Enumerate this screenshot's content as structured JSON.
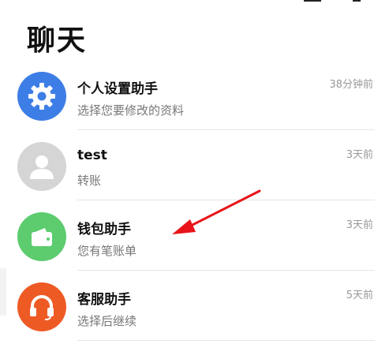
{
  "page": {
    "title": "聊天"
  },
  "chats": [
    {
      "name": "个人设置助手",
      "preview": "选择您要修改的资料",
      "time": "38分钟前",
      "icon": "gear-icon",
      "color": "#3d7de6"
    },
    {
      "name": "test",
      "preview": "转账",
      "time": "3天前",
      "icon": "person-icon",
      "color": "#d5d5d5"
    },
    {
      "name": "钱包助手",
      "preview": "您有笔账单",
      "time": "3天前",
      "icon": "wallet-icon",
      "color": "#5ccc6e"
    },
    {
      "name": "客服助手",
      "preview": "选择后继续",
      "time": "5天前",
      "icon": "headset-icon",
      "color": "#ee5a24"
    }
  ],
  "annotation": {
    "color": "#e8141a"
  }
}
